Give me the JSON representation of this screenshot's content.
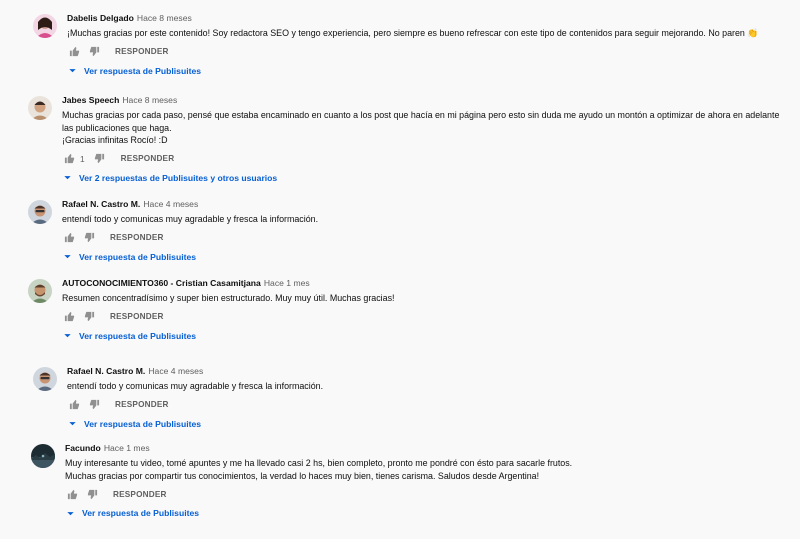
{
  "ui": {
    "reply_label": "RESPONDER"
  },
  "colors": {
    "accent": "#065fd4",
    "muted": "#606060",
    "icon": "#909090"
  },
  "comments": [
    {
      "author": "Dabelis Delgado",
      "time": "Hace 8 meses",
      "text": "¡Muchas gracias por este contenido! Soy redactora SEO y tengo experiencia, pero siempre es bueno refrescar con este tipo de contenidos para seguir mejorando. No paren 👏",
      "likes": "",
      "replies": "Ver respuesta de Publisuites",
      "avatar": "avatar-woman-pink"
    },
    {
      "author": "Jabes Speech",
      "time": "Hace 8 meses",
      "text": "Muchas gracias por cada paso, pensé que estaba encaminado en cuanto a los post que hacía en mi página pero esto sin duda me ayudo un montón a optimizar de ahora en adelante las publicaciones que haga.\n¡Gracias infinitas Rocío! :D",
      "likes": "1",
      "replies": "Ver 2 respuestas de Publisuites y otros usuarios",
      "avatar": "avatar-man-light"
    },
    {
      "author": "Rafael N. Castro M.",
      "time": "Hace 4 meses",
      "text": "entendí todo y comunicas muy agradable y fresca la información.",
      "likes": "",
      "replies": "Ver respuesta de Publisuites",
      "avatar": "avatar-man-glasses"
    },
    {
      "author": "AUTOCONOCIMIENTO360 - Cristian Casamitjana",
      "time": "Hace 1 mes",
      "text": "Resumen concentradísimo y super bien estructurado. Muy muy útil. Muchas gracias!",
      "likes": "",
      "replies": "Ver respuesta de Publisuites",
      "avatar": "avatar-man-beard"
    },
    {
      "author": "Rafael N. Castro M.",
      "time": "Hace 4 meses",
      "text": "entendí todo y comunicas muy agradable y fresca la información.",
      "likes": "",
      "replies": "Ver respuesta de Publisuites",
      "avatar": "avatar-man-glasses"
    },
    {
      "author": "Facundo",
      "time": "Hace 1 mes",
      "text": "Muy interesante tu video, tomé apuntes y me ha llevado casi 2 hs, bien completo, pronto me pondré con ésto para sacarle frutos.\nMuchas gracias por compartir tus conocimientos, la verdad lo haces muy bien, tienes carisma. Saludos desde Argentina!",
      "likes": "",
      "replies": "Ver respuesta de Publisuites",
      "avatar": "avatar-dark-landscape"
    }
  ]
}
